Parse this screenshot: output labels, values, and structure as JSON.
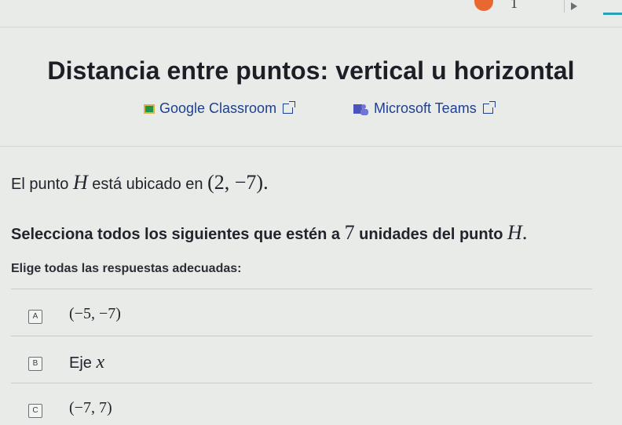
{
  "toolbar": {
    "step_number": "1"
  },
  "title": "Distancia entre puntos: vertical u horizontal",
  "share": {
    "google_classroom": "Google Classroom",
    "microsoft_teams": "Microsoft Teams"
  },
  "problem": {
    "statement_pre": "El punto ",
    "point_name": "H",
    "statement_mid": " está ubicado en ",
    "point_coords": "(2, −7)",
    "statement_post": ".",
    "prompt_pre": "Selecciona todos los siguientes que estén a ",
    "distance": "7",
    "prompt_mid": " unidades del punto ",
    "prompt_point": "H",
    "prompt_post": ".",
    "instructions": "Elige todas las respuestas adecuadas:"
  },
  "choices": [
    {
      "letter": "A",
      "text": "(−5, −7)"
    },
    {
      "letter": "B",
      "label": "Eje ",
      "math": "x"
    },
    {
      "letter": "C",
      "text": "(−7, 7)"
    }
  ],
  "colors": {
    "progress": "#e8692f",
    "accent": "#2d9fb6",
    "link": "#1f3f8f"
  },
  "icons": [
    "play-icon",
    "google-classroom-icon",
    "microsoft-teams-icon",
    "external-link-icon"
  ]
}
